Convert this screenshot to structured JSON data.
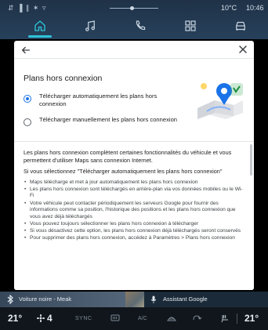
{
  "status": {
    "left_icons": "⇵ ▐ ∥ ✶ ▿",
    "outside_temp": "10°C",
    "time": "10:46"
  },
  "nav": {
    "tabs": [
      {
        "icon": "home-icon",
        "active": true
      },
      {
        "icon": "music-note-icon",
        "active": false
      },
      {
        "icon": "phone-icon",
        "active": false
      },
      {
        "icon": "apps-grid-icon",
        "active": false
      },
      {
        "icon": "car-icon",
        "active": false
      }
    ]
  },
  "dialog": {
    "title": "Plans hors connexion",
    "options": [
      {
        "label": "Télécharger automatiquement les plans hors connexion",
        "checked": true
      },
      {
        "label": "Télécharger manuellement les plans hors connexion",
        "checked": false
      }
    ],
    "intro": "Les plans hors connexion complètent certaines fonctionnalités du véhicule et vous permettent d'utiliser Maps sans connexion Internet.",
    "if_selected": "Si vous sélectionnez \"Télécharger automatiquement les plans hors connexion\"",
    "bullets": [
      "Maps télécharge et met à jour automatiquement les plans hors connexion",
      "Les plans hors connexion sont téléchargés en arrière-plan via vos données mobiles ou le Wi-Fi",
      "Votre véhicule peut contacter périodiquement les serveurs Google pour fournir des informations comme sa position, l'historique des positions et les plans hors connexion que vous avez déjà téléchargés",
      "Vous pouvez toujours sélectionner les plans hors connexion à télécharger",
      "Si vous désactivez cette option, les plans hors connexion déjà téléchargés seront conservés",
      "Pour supprimer des plans hors connexion, accédez à Paramètres > Plans hors connexion"
    ]
  },
  "media": {
    "track": "Voiture noire - Meak",
    "assistant_label": "Assistant Google"
  },
  "climate": {
    "temp_left": "21°",
    "fan_level": "4",
    "sync_label": "SYNC",
    "ac_label": "A/C",
    "temp_right": "21°"
  },
  "colors": {
    "accent": "#2ec4d8",
    "radio_selected": "#1a73e8",
    "topbar": "#27415c"
  }
}
